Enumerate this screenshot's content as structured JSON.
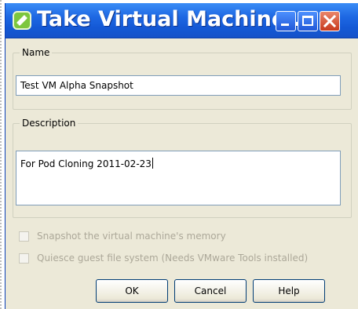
{
  "window": {
    "title": "Take Virtual Machine ...",
    "colors": {
      "titlebar": "#1e68e3",
      "close": "#c8391d",
      "body": "#ece9d8"
    },
    "controls": {
      "minimize_icon": "minimize-icon",
      "maximize_icon": "maximize-icon",
      "close_icon": "close-icon"
    }
  },
  "name": {
    "legend": "Name",
    "value": "Test VM Alpha Snapshot"
  },
  "description": {
    "legend": "Description",
    "value": "For Pod Cloning 2011-02-23"
  },
  "options": [
    {
      "label": "Snapshot the virtual machine's memory",
      "checked": false,
      "enabled": false
    },
    {
      "label": "Quiesce guest file system (Needs VMware Tools installed)",
      "checked": false,
      "enabled": false
    }
  ],
  "buttons": {
    "ok": "OK",
    "cancel": "Cancel",
    "help": "Help"
  }
}
